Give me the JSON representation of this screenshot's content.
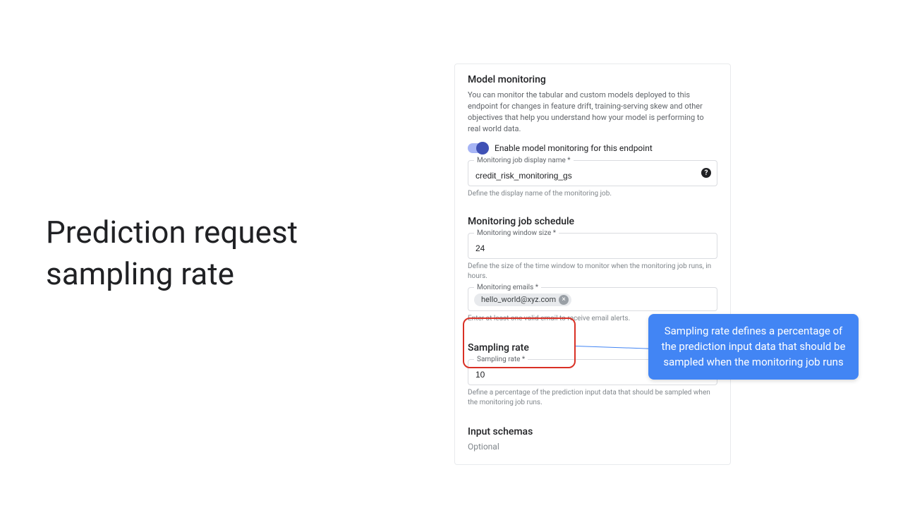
{
  "slide": {
    "title": "Prediction request sampling rate"
  },
  "panel": {
    "heading": "Model monitoring",
    "description": "You can monitor the tabular and custom models deployed to this endpoint for changes in feature drift, training-serving skew and other objectives that help you understand how your model is performing to real world data.",
    "toggle_label": "Enable model monitoring for this endpoint",
    "toggle_on": true,
    "fields": {
      "display_name": {
        "label": "Monitoring job display name *",
        "value": "credit_risk_monitoring_gs",
        "helper": "Define the display name of the monitoring job."
      }
    },
    "schedule": {
      "heading": "Monitoring job schedule",
      "window": {
        "label": "Monitoring window size *",
        "value": "24",
        "helper": "Define the size of the time window to monitor when the monitoring job runs, in hours."
      },
      "emails": {
        "label": "Monitoring emails *",
        "chip": "hello_world@xyz.com",
        "helper": "Enter at least one valid email to receive email alerts."
      }
    },
    "sampling": {
      "heading": "Sampling rate",
      "rate": {
        "label": "Sampling rate *",
        "value": "10",
        "helper": "Define a percentage of the prediction input data that should be sampled when the monitoring job runs."
      }
    },
    "schemas": {
      "heading": "Input schemas",
      "optional": "Optional"
    }
  },
  "callout": {
    "text": "Sampling rate defines a percentage of the prediction input data that should be sampled when the monitoring job runs"
  }
}
